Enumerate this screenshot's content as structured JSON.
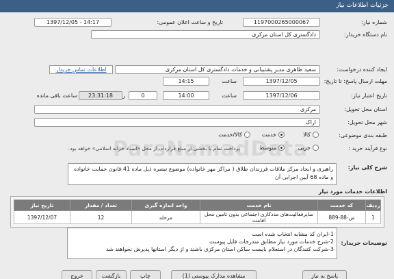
{
  "header": {
    "title": "جزئیات اطلاعات نیاز"
  },
  "labels": {
    "need_number": "شماره نیاز:",
    "announce_datetime": "تاریخ و ساعت اعلان عمومی:",
    "buyer_org": "نام دستگاه خریدار:",
    "requester": "ایجاد کننده درخواست:",
    "reply_deadline": "مهلت ارسال پاسخ: تا تاریخ:",
    "validity_deadline": "تاریخ اعتبار نیاز:",
    "delivery_province": "استان محل تحویل:",
    "delivery_city": "شهر محل تحویل:",
    "category": "طبقه بندی موضوعی:",
    "process_type": "نوع فرآیند خرید :",
    "hour": "ساعت",
    "hour2": "ساعت",
    "day_and": "روز و",
    "remaining": "ساعت باقی مانده",
    "summary": "شرح کلی نیاز:",
    "services_info": "اطلاعات خدمات مورد نیاز",
    "buyer_desc": "توضیحات خریدار:"
  },
  "fields": {
    "need_number": "1197000265000067",
    "announce_datetime": "1397/12/05 - 14:17",
    "buyer_org": "دادگستری کل استان مرکزی",
    "requester": "سعید طاهری مدیر پشتیبانی و خدمات دادگستری کل استان مرکزی",
    "contact_link": "اطلاعات تماس خریدار",
    "reply_date": "1397/12/05",
    "reply_time": "14:15",
    "validity_date": "1397/12/06",
    "validity_time": "14:00",
    "remaining_days": "0",
    "remaining_time": "23:31:18",
    "province": "مرکزی",
    "city": "اراک"
  },
  "category_options": [
    {
      "label": "کالا",
      "checked": false
    },
    {
      "label": "خدمت",
      "checked": true
    },
    {
      "label": "کالا/خدمت",
      "checked": false
    }
  ],
  "process_options": [
    {
      "label": "جزیی",
      "checked": false
    },
    {
      "label": "متوسط",
      "checked": true
    }
  ],
  "process_note": "پرداخت تمام یا بخشی از مبلغ قرارداد، از محل «اسناد خزانه اسلامی» خواهد بود.",
  "summary_text": "راهبری و ایجاد مرکز ملاقات  فرزندان طلاق ( مراکز مهر خانواده) موضوع تبصره ذیل ماده 41 قانون حمایت خانواده و ماده 68 آیین اجرایی آن",
  "table": {
    "headers": [
      "ردیف",
      "کد خدمت",
      "نام خدمت",
      "واحد اندازه گیری",
      "تعداد / مقدار",
      "تاریخ نیاز"
    ],
    "rows": [
      [
        "1",
        "ص-88-889",
        "سایرفعالیت‌های مددکاری اجتماعی بدون تامین محل اقامت",
        "مرحله",
        "12",
        "1397/12/07"
      ]
    ]
  },
  "buyer_lines": [
    "1-ایران کد مشابه انتخاب شده است",
    "2-شرح خدمات مورد نیاز مطابق مندرجات فایل پیوست",
    "3-شرکت کنندگان در استعلام بایست ساکن استان مرکزی باشند و از دیگر استانها پذیرش نخواهند شد"
  ],
  "buttons": {
    "reply": "پاسخ به نیاز",
    "attachments": "مشاهده مدارک پیوستی (1)",
    "print": "چاپ",
    "back": "بازگشت",
    "exit": "خروج"
  },
  "watermark": "ParsNamadData"
}
